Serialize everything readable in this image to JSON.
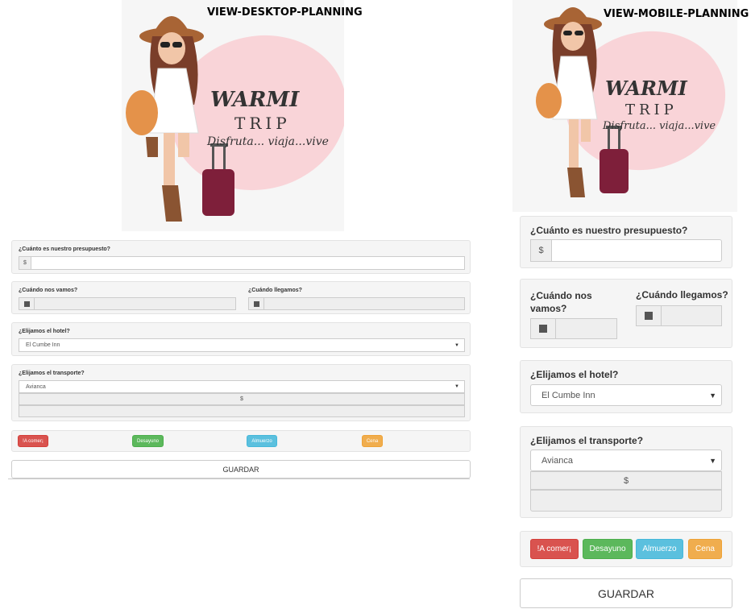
{
  "desktop": {
    "view_label": "VIEW-DESKTOP-PLANNING",
    "logo": {
      "brand": "WARMI",
      "sub": "TRIP",
      "tagline": "Disfruta... viaja...vive"
    },
    "budget": {
      "label": "¿Cuánto es nuestro presupuesto?",
      "addon": "$",
      "value": ""
    },
    "dates": {
      "depart_label": "¿Cuándo nos vamos?",
      "arrive_label": "¿Cuándo llegamos?",
      "calendar_icon": "calendar-icon"
    },
    "hotel": {
      "label": "¿Elijamos el hotel?",
      "selected": "El Cumbe Inn"
    },
    "transport": {
      "label": "¿Elijamos el transporte?",
      "selected": "Avianca",
      "addon": "$",
      "value": ""
    },
    "meals": [
      {
        "label": "!A comer¡",
        "color": "#d9534f"
      },
      {
        "label": "Desayuno",
        "color": "#5cb85c"
      },
      {
        "label": "Almuerzo",
        "color": "#5bc0de"
      },
      {
        "label": "Cena",
        "color": "#f0ad4e"
      }
    ],
    "save_label": "GUARDAR"
  },
  "mobile": {
    "view_label": "VIEW-MOBILE-PLANNING",
    "logo": {
      "brand": "WARMI",
      "sub": "TRIP",
      "tagline": "Disfruta... viaja...vive"
    },
    "budget": {
      "label": "¿Cuánto es nuestro presupuesto?",
      "addon": "$",
      "value": ""
    },
    "dates": {
      "depart_label": "¿Cuándo nos vamos?",
      "arrive_label": "¿Cuándo llegamos?",
      "calendar_icon": "calendar-icon"
    },
    "hotel": {
      "label": "¿Elijamos el hotel?",
      "selected": "El Cumbe Inn"
    },
    "transport": {
      "label": "¿Elijamos el transporte?",
      "selected": "Avianca",
      "addon": "$",
      "value": ""
    },
    "meals": [
      {
        "label": "!A comer¡",
        "color": "#d9534f"
      },
      {
        "label": "Desayuno",
        "color": "#5cb85c"
      },
      {
        "label": "Almuerzo",
        "color": "#5bc0de"
      },
      {
        "label": "Cena",
        "color": "#f0ad4e"
      }
    ],
    "save_label": "GUARDAR"
  }
}
